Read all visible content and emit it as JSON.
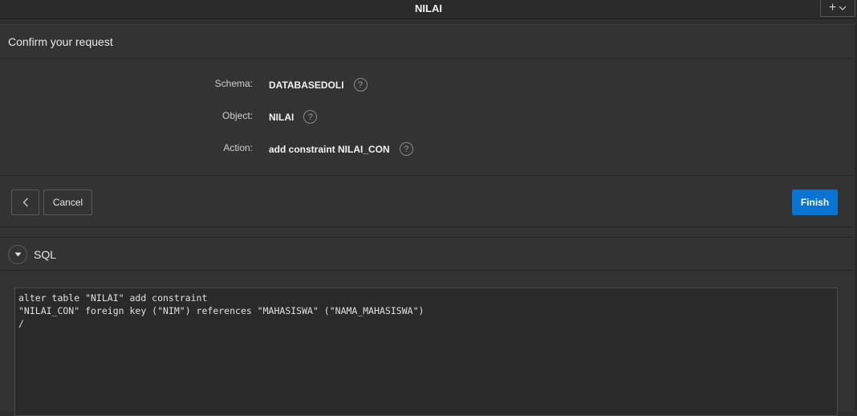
{
  "window": {
    "title": "NILAI",
    "add_menu_label": "+",
    "add_menu_icon": "chevron-down-icon"
  },
  "dialog": {
    "title": "Confirm your request"
  },
  "summary": {
    "rows": [
      {
        "label": "Schema:",
        "value": "DATABASEDOLI",
        "help_icon": "question-circle-icon"
      },
      {
        "label": "Object:",
        "value": "NILAI",
        "help_icon": "question-circle-icon"
      },
      {
        "label": "Action:",
        "value": "add constraint NILAI_CON",
        "help_icon": "question-circle-icon"
      }
    ],
    "help_glyph": "?"
  },
  "actions": {
    "back_icon": "chevron-left-icon",
    "cancel_label": "Cancel",
    "finish_label": "Finish"
  },
  "sql": {
    "section_title": "SQL",
    "toggle_icon": "triangle-down-icon",
    "code": "alter table \"NILAI\" add constraint\n\"NILAI_CON\" foreign key (\"NIM\") references \"MAHASISWA\" (\"NAMA_MAHASISWA\")\n/"
  },
  "colors": {
    "background": "#333333",
    "accent": "#0a74d3",
    "text": "#e6e6e6"
  }
}
